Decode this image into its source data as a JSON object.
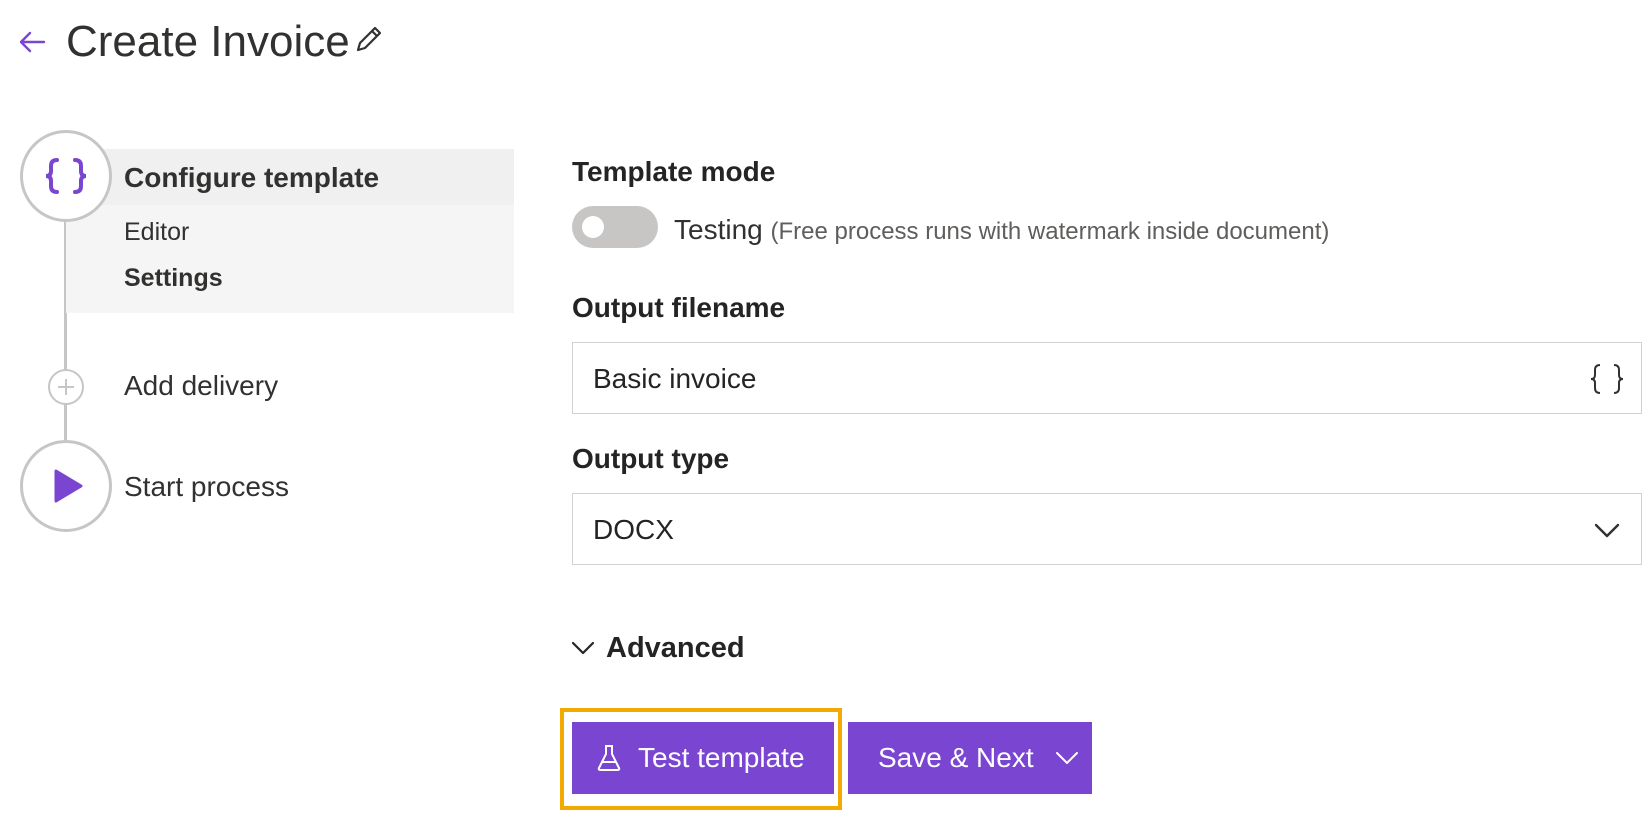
{
  "header": {
    "title": "Create Invoice",
    "back_icon": "arrow-left-icon",
    "edit_icon": "pencil-icon"
  },
  "stepper": {
    "steps": [
      {
        "label": "Configure template",
        "icon": "braces-icon",
        "sub_items": [
          {
            "label": "Editor"
          },
          {
            "label": "Settings"
          }
        ]
      },
      {
        "label": "Add delivery",
        "icon": "plus-circle-icon"
      },
      {
        "label": "Start process",
        "icon": "play-icon"
      }
    ]
  },
  "form": {
    "template_mode": {
      "label": "Template mode",
      "toggle_state": "off",
      "toggle_text": "Testing",
      "toggle_note": "(Free process runs with watermark inside document)"
    },
    "output_filename": {
      "label": "Output filename",
      "value": "Basic invoice",
      "icon": "braces-icon"
    },
    "output_type": {
      "label": "Output type",
      "selected": "DOCX",
      "icon": "chevron-down-icon"
    },
    "advanced": {
      "label": "Advanced",
      "icon": "chevron-down-icon"
    }
  },
  "actions": {
    "test_label": "Test template",
    "test_icon": "flask-icon",
    "save_label": "Save & Next",
    "save_icon": "chevron-down-icon"
  },
  "colors": {
    "accent": "#7a45d0",
    "focus": "#f2a900",
    "border": "#c8c6c4"
  }
}
